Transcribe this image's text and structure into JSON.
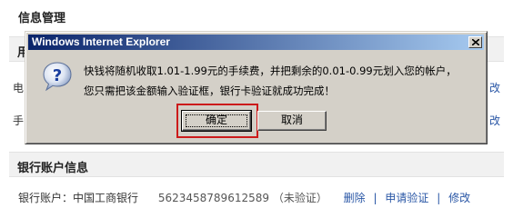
{
  "page": {
    "title": "信息管理",
    "band1_partial": "用",
    "row_partial_1": "电",
    "row_partial_2": "手",
    "right_partial_1": "改",
    "right_partial_2": "改"
  },
  "bank_section": {
    "title": "银行账户信息",
    "label": "银行账户：中国工商银行",
    "account_number": "5623458789612589",
    "status": "（未验证）",
    "links": [
      "删除",
      "申请验证",
      "修改"
    ],
    "separator": "|"
  },
  "dialog": {
    "title": "Windows Internet Explorer",
    "icon": "question-icon",
    "message_line1": "快钱将随机收取1.01-1.99元的手续费，并把剩余的0.01-0.99元划入您的帐户，",
    "message_line2": "您只需把该金额输入验证框，银行卡验证就成功完成！",
    "ok_label": "确定",
    "cancel_label": "取消",
    "close_icon": "close-icon",
    "titlebar_color_start": "#0a246a",
    "titlebar_color_end": "#a6caf0",
    "highlight_color": "#cc1a1a"
  }
}
